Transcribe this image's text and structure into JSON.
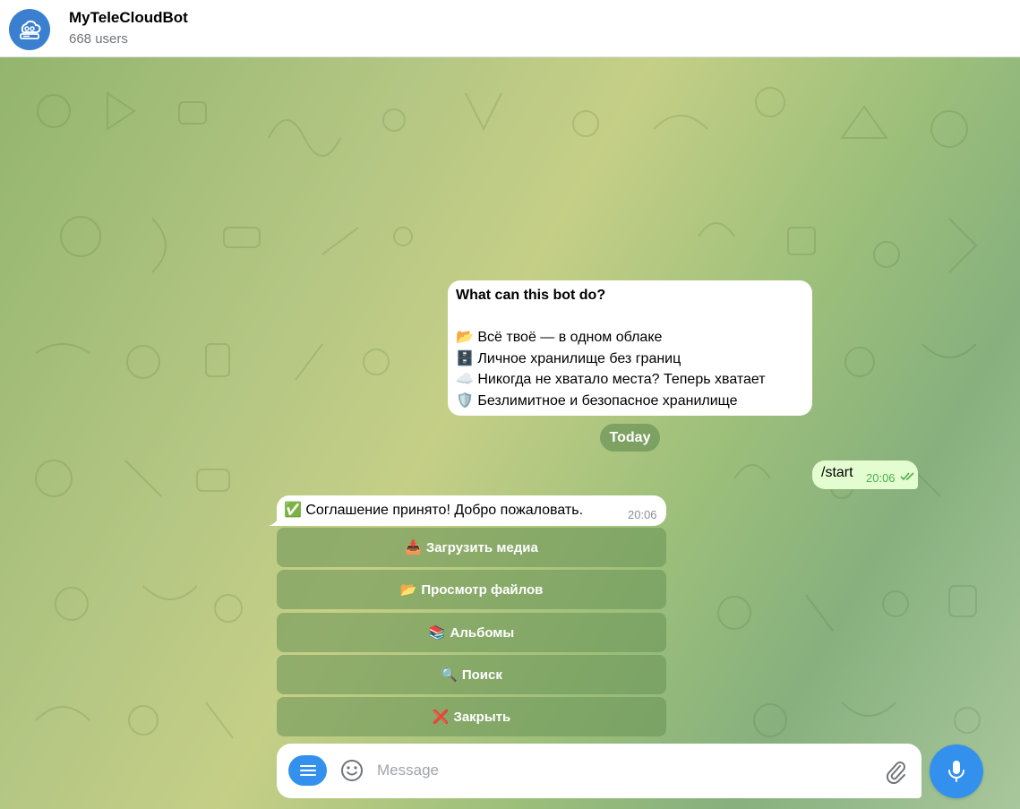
{
  "header": {
    "name": "MyTeleCloudBot",
    "subtitle": "668 users"
  },
  "intro": {
    "title": "What can this bot do?",
    "lines": [
      {
        "emoji": "📂",
        "text": "Всё твоё — в одном облаке"
      },
      {
        "emoji": "🗄️",
        "text": "Личное хранилище без границ"
      },
      {
        "emoji": "☁️",
        "text": "Никогда не хватало места? Теперь хватает"
      },
      {
        "emoji": "🛡️",
        "text": "Безлимитное и безопасное хранилище"
      }
    ]
  },
  "date_divider": "Today",
  "outgoing": {
    "text": "/start",
    "time": "20:06"
  },
  "incoming": {
    "text": "✅ Соглашение принято! Добро пожаловать.",
    "time": "20:06"
  },
  "keyboard": [
    {
      "emoji": "📥",
      "label": "Загрузить медиа"
    },
    {
      "emoji": "📂",
      "label": "Просмотр файлов"
    },
    {
      "emoji": "📚",
      "label": "Альбомы"
    },
    {
      "emoji": "🔍",
      "label": "Поиск"
    },
    {
      "emoji": "❌",
      "label": "Закрыть"
    }
  ],
  "composer": {
    "placeholder": "Message"
  },
  "icons": {
    "avatar": "cloud-server-icon",
    "menu": "menu-icon",
    "emoji": "smile-icon",
    "attach": "paperclip-icon",
    "mic": "microphone-icon",
    "read": "double-check-icon"
  },
  "colors": {
    "accent": "#3390ec",
    "outgoing_bubble": "#e3fdd0",
    "check": "#4fae4e"
  }
}
